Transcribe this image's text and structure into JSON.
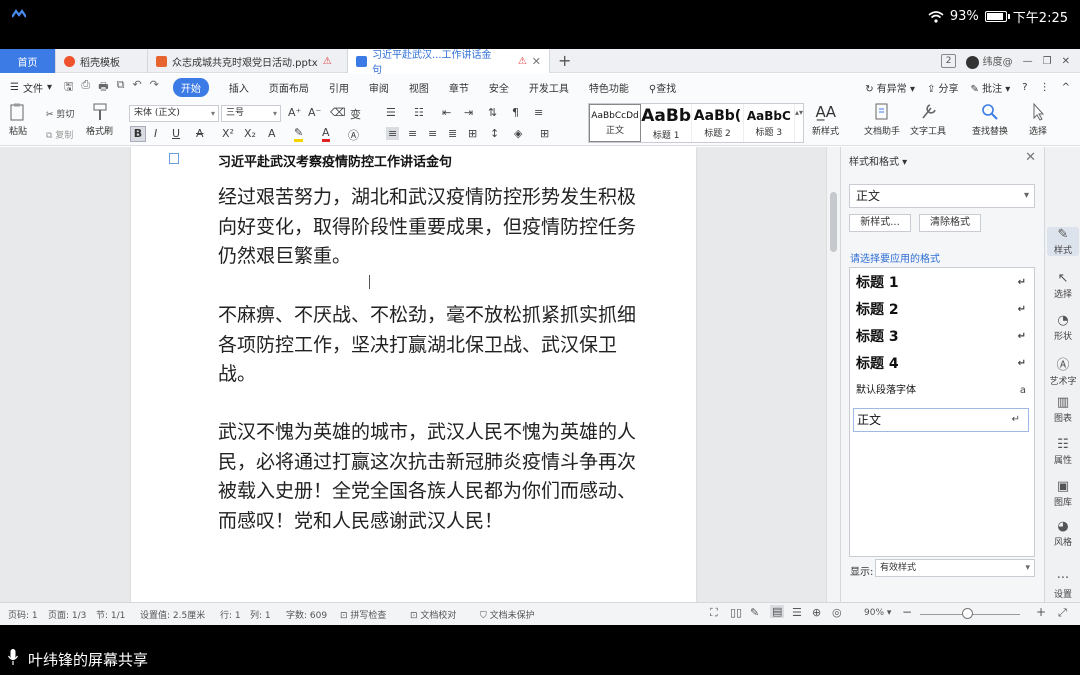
{
  "statusbar": {
    "battery": "93%",
    "time": "下午2:25",
    "battery_level": 0.93
  },
  "tabs": {
    "home": "首页",
    "items": [
      {
        "label": "稻壳模板",
        "color": "#f0522d"
      },
      {
        "label": "众志成城共克时艰党日活动.pptx",
        "color": "#e8642f"
      },
      {
        "label": "习近平赴武汉...工作讲话金句",
        "color": "#3c7be6"
      }
    ],
    "page_badge": "2",
    "user": "纬度@"
  },
  "menu": {
    "file": "文件",
    "items": [
      "开始",
      "插入",
      "页面布局",
      "引用",
      "审阅",
      "视图",
      "章节",
      "安全",
      "开发工具",
      "特色功能"
    ],
    "search": "查找",
    "right": [
      "有异常",
      "分享",
      "批注"
    ]
  },
  "ribbon": {
    "paste": "粘贴",
    "cut": "剪切",
    "copy": "复制",
    "format_painter": "格式刷",
    "font": "宋体 (正文)",
    "size": "三号",
    "styles": [
      {
        "preview": "AaBbCcDd",
        "name": "正文"
      },
      {
        "preview": "AaBb",
        "name": "标题 1"
      },
      {
        "preview": "AaBb(",
        "name": "标题 2"
      },
      {
        "preview": "AaBbC",
        "name": "标题 3"
      }
    ],
    "new_style": "新样式",
    "text_assistant": "文档助手",
    "text_tools": "文字工具",
    "find_replace": "查找替换",
    "select": "选择"
  },
  "document": {
    "heading": "习近平赴武汉考察疫情防控工作讲话金句",
    "paragraphs": [
      "经过艰苦努力，湖北和武汉疫情防控形势发生积极向好变化，取得阶段性重要成果，但疫情防控任务仍然艰巨繁重。",
      "不麻痹、不厌战、不松劲，毫不放松抓紧抓实抓细各项防控工作，坚决打赢湖北保卫战、武汉保卫战。",
      "武汉不愧为英雄的城市，武汉人民不愧为英雄的人民，必将通过打赢这次抗击新冠肺炎疫情斗争再次被载入史册！全党全国各族人民都为你们而感动、而感叹！党和人民感谢武汉人民！"
    ]
  },
  "panel": {
    "title": "样式和格式",
    "current": "正文",
    "new_style_btn": "新样式...",
    "clear_btn": "清除格式",
    "apply_label": "请选择要应用的格式",
    "styles": [
      {
        "name": "标题  1",
        "mark": "↵"
      },
      {
        "name": "标题  2",
        "mark": "↵"
      },
      {
        "name": "标题  3",
        "mark": "↵"
      },
      {
        "name": "标题  4",
        "mark": "↵"
      },
      {
        "name": "默认段落字体",
        "mark": "a"
      },
      {
        "name": "正文",
        "mark": "↵"
      }
    ],
    "show_label": "显示:",
    "show_value": "有效样式"
  },
  "strip": [
    "样式",
    "选择",
    "形状",
    "艺术字",
    "图表",
    "属性",
    "图库",
    "风格",
    "设置"
  ],
  "docstatus": {
    "page": "页码: 1",
    "pages": "页面: 1/3",
    "section": "节: 1/1",
    "setting": "设置值: 2.5厘米",
    "row": "行: 1",
    "col": "列: 1",
    "words": "字数: 609",
    "spell": "拼写检查",
    "proof": "文档校对",
    "protect": "文档未保护",
    "zoom": "90%"
  },
  "share": "叶纬锋的屏幕共享",
  "colors": {
    "accent": "#3c7be6"
  }
}
